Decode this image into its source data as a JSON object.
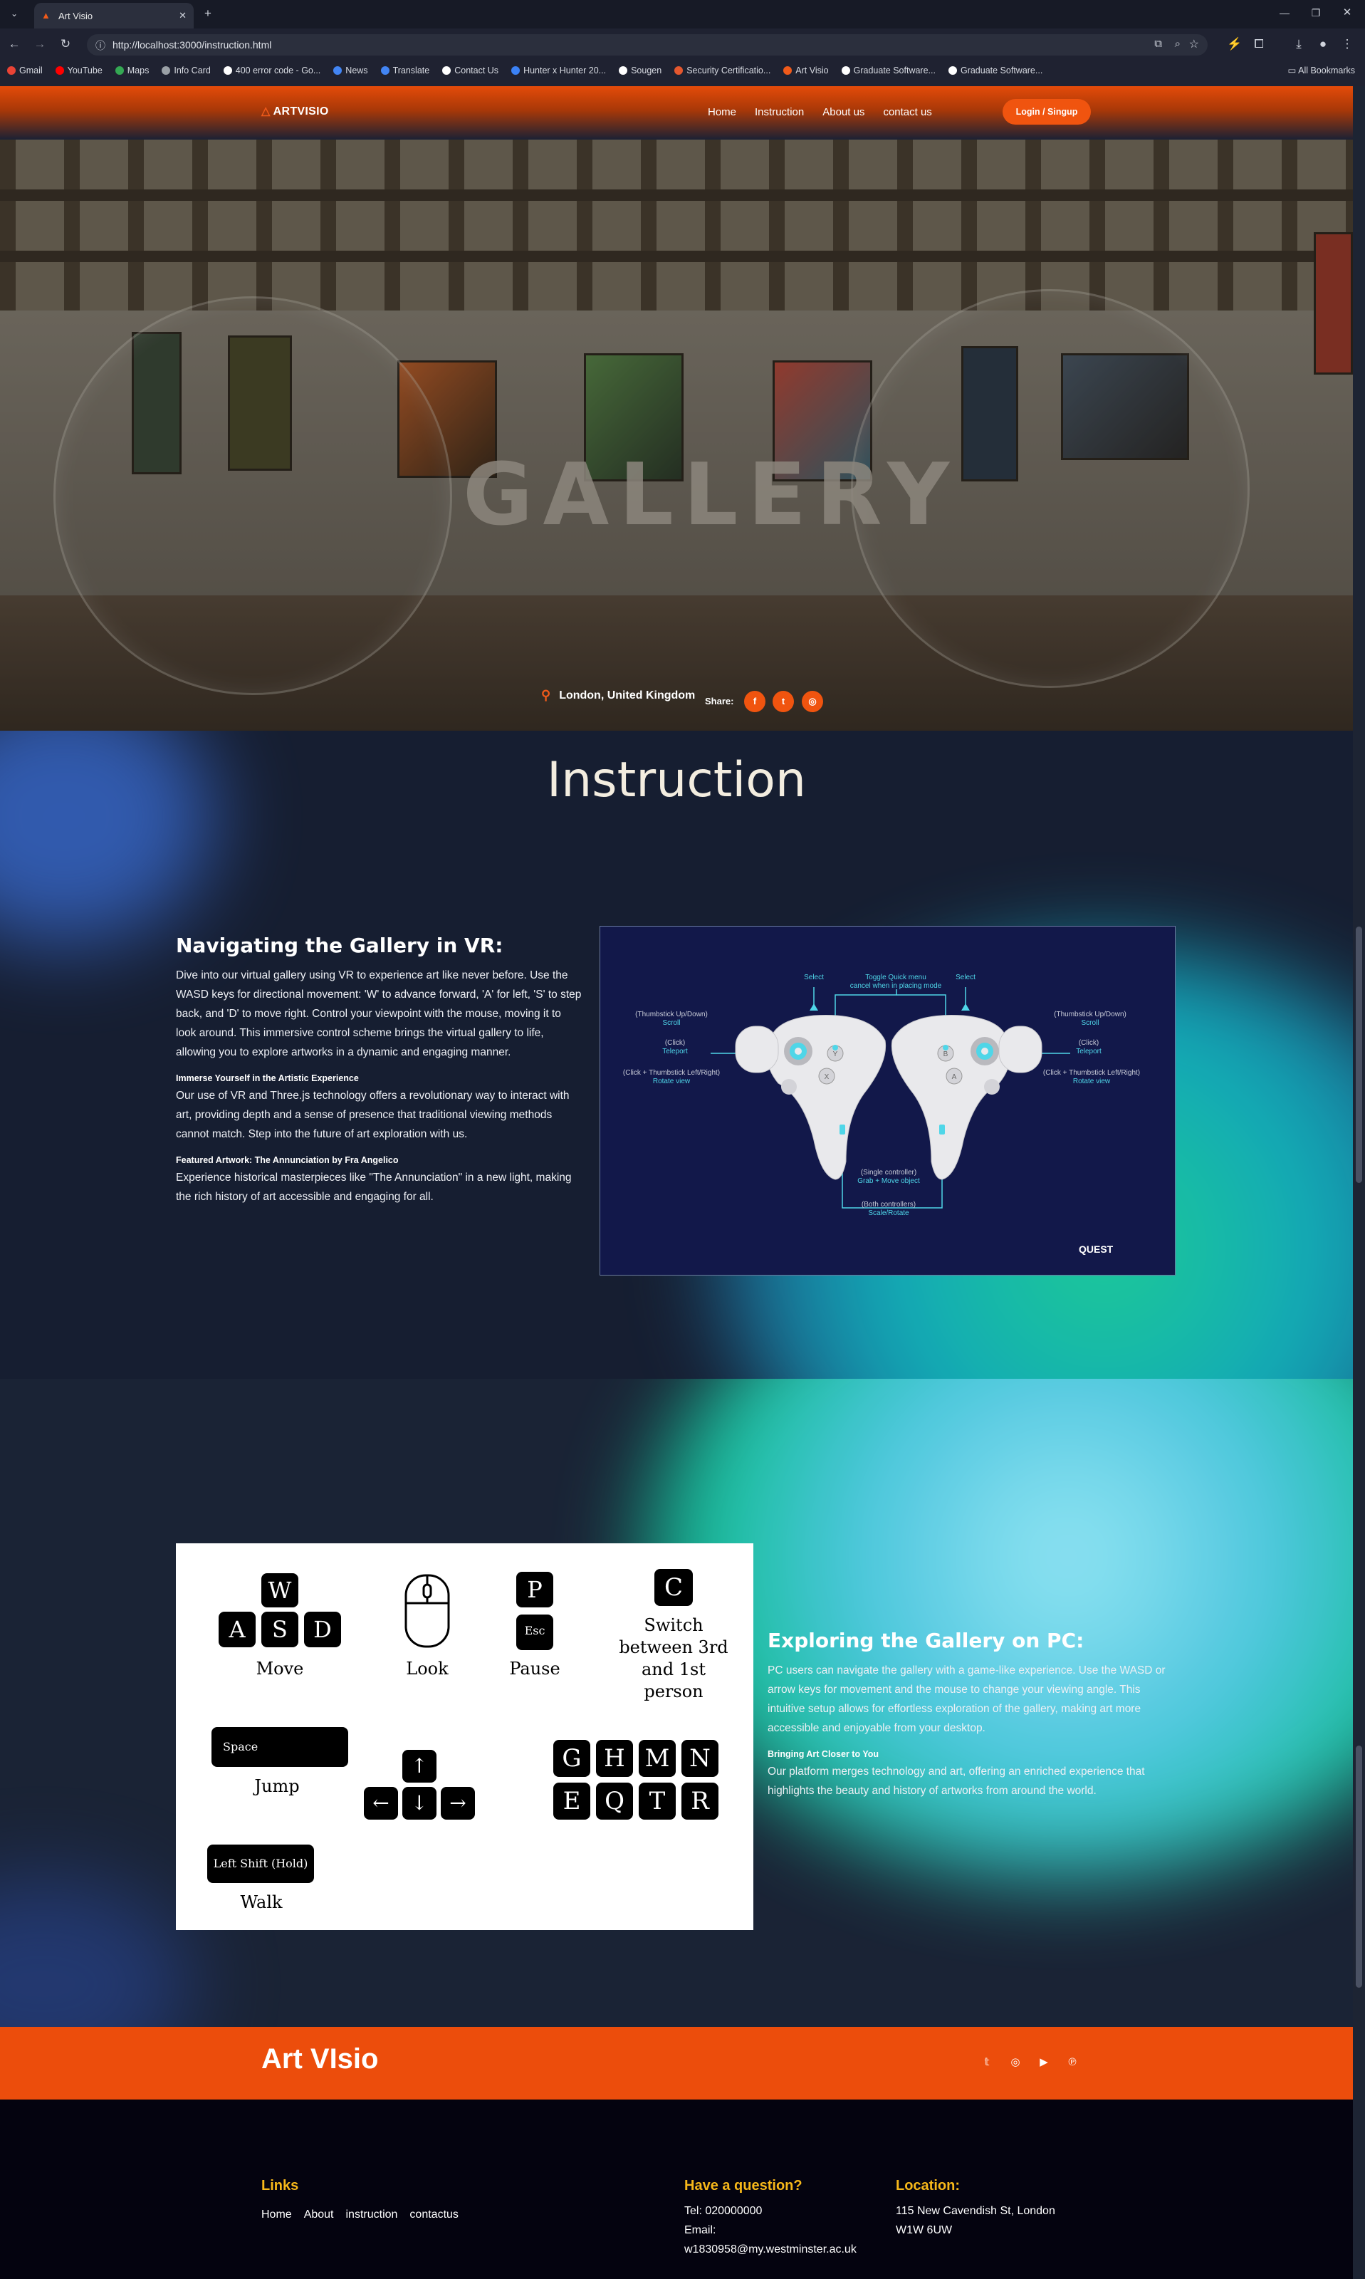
{
  "browser": {
    "tab_title": "Art Visio",
    "url": "http://localhost:3000/instruction.html",
    "bookmarks": [
      {
        "label": "Gmail",
        "color": "#ea4335"
      },
      {
        "label": "YouTube",
        "color": "#ff0000"
      },
      {
        "label": "Maps",
        "color": "#34a853"
      },
      {
        "label": "Info Card",
        "color": "#9aa0a6"
      },
      {
        "label": "400 error code - Go...",
        "color": "#ffffff"
      },
      {
        "label": "News",
        "color": "#4285f4"
      },
      {
        "label": "Translate",
        "color": "#4285f4"
      },
      {
        "label": "Contact Us",
        "color": "#ffffff"
      },
      {
        "label": "Hunter x Hunter 20...",
        "color": "#3b82f6"
      },
      {
        "label": "Sougen",
        "color": "#ffffff"
      },
      {
        "label": "Security Certificatio...",
        "color": "#e4572e"
      },
      {
        "label": "Art Visio",
        "color": "#f05a1a"
      },
      {
        "label": "Graduate Software...",
        "color": "#ffffff"
      },
      {
        "label": "Graduate Software...",
        "color": "#ffffff"
      }
    ],
    "all_bookmarks": "All Bookmarks"
  },
  "nav": {
    "logo": "ARTVISIO",
    "links": [
      "Home",
      "Instruction",
      "About us",
      "contact us"
    ],
    "login": "Login / Singup"
  },
  "hero": {
    "watermark": "GALLERY",
    "location": "London, United Kingdom",
    "share_label": "Share:"
  },
  "instruction": {
    "title": "Instruction",
    "vr_heading": "Navigating the Gallery in VR:",
    "vr_body": "Dive into our virtual gallery using VR to experience art like never before. Use the WASD keys for directional movement: 'W' to advance forward, 'A' for left, 'S' to step back, and 'D' to move right. Control your viewpoint with the mouse, moving it to look around. This immersive control scheme brings the virtual gallery to life, allowing you to explore artworks in a dynamic and engaging manner.",
    "immerse_heading": "Immerse Yourself in the Artistic Experience",
    "immerse_body": "Our use of VR and Three.js technology offers a revolutionary way to interact with art, providing depth and a sense of presence that traditional viewing methods cannot match. Step into the future of art exploration with us.",
    "featured_heading": "Featured Artwork: The Annunciation by Fra Angelico",
    "featured_body": "Experience historical masterpieces like \"The Annunciation\" in a new light, making the rich history of art accessible and engaging for all.",
    "controller": {
      "quest": "QUEST",
      "select_left": "Select",
      "select_right": "Select",
      "toggle_menu": "Toggle Quick menu",
      "toggle_menu_sub": "cancel when in placing mode",
      "thumb_ud_left": "(Thumbstick Up/Down)",
      "thumb_ud_left_action": "Scroll",
      "click_left": "(Click)",
      "click_left_action": "Teleport",
      "rotate_left": "(Click + Thumbstick Left/Right)",
      "rotate_left_action": "Rotate view",
      "thumb_ud_right": "(Thumbstick Up/Down)",
      "thumb_ud_right_action": "Scroll",
      "click_right": "(Click)",
      "click_right_action": "Teleport",
      "rotate_right": "(Click + Thumbstick Left/Right)",
      "rotate_right_action": "Rotate view",
      "single": "(Single controller)",
      "single_action": "Grab + Move object",
      "both": "(Both controllers)",
      "both_action": "Scale/Rotate",
      "btn_y": "Y",
      "btn_x": "X",
      "btn_b": "B",
      "btn_a": "A"
    }
  },
  "pc": {
    "heading": "Exploring the Gallery on PC:",
    "body": "PC users can navigate the gallery with a game-like experience. Use the WASD or arrow keys for movement and the mouse to change your viewing angle. This intuitive setup allows for effortless exploration of the gallery, making art more accessible and enjoyable from your desktop.",
    "closer_heading": "Bringing Art Closer to You",
    "closer_body": "Our platform merges technology and art, offering an enriched experience that highlights the beauty and history of artworks from around the world.",
    "keys": {
      "w": "W",
      "a": "A",
      "s": "S",
      "d": "D",
      "move": "Move",
      "look": "Look",
      "p": "P",
      "esc": "Esc",
      "pause": "Pause",
      "c": "C",
      "switch": "Switch between 3rd and 1st person",
      "space": "Space",
      "jump": "Jump",
      "up": "↑",
      "left": "←",
      "down": "↓",
      "right": "→",
      "g": "G",
      "h": "H",
      "m": "M",
      "n": "N",
      "e": "E",
      "q": "Q",
      "t": "T",
      "r": "R",
      "shift": "Left Shift (Hold)",
      "walk": "Walk"
    }
  },
  "footer": {
    "brand": "Art VIsio",
    "links_heading": "Links",
    "links": [
      "Home",
      "About",
      "instruction",
      "contactus"
    ],
    "question_heading": "Have a question?",
    "tel": "Tel: 020000000",
    "email_label": "Email:",
    "email": "w1830958@my.westminster.ac.uk",
    "location_heading": "Location:",
    "address_line1": "115 New Cavendish St, London",
    "address_line2": "W1W 6UW"
  }
}
